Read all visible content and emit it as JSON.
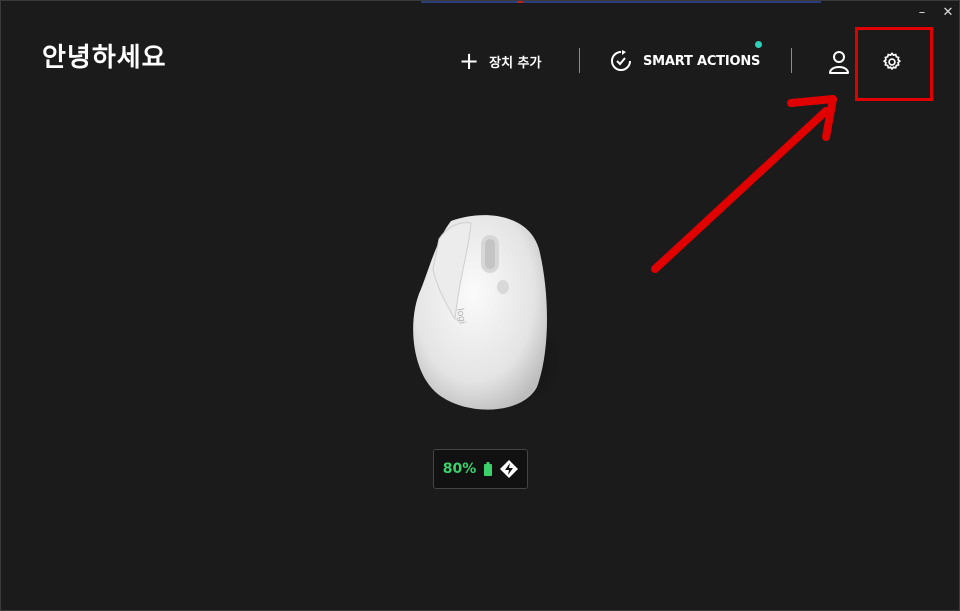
{
  "window": {
    "minimize_label": "–",
    "close_label": "✕"
  },
  "header": {
    "greeting": "안녕하세요",
    "add_device_label": "장치 추가",
    "smart_actions_label": "SMART ACTIONS",
    "notification_color": "#2ed0b8"
  },
  "device": {
    "battery_percent": "80%",
    "battery_color": "#3ad16a",
    "device_logo_text": "logi"
  },
  "icons": {
    "add": "plus-icon",
    "smart_actions": "smart-actions-icon",
    "account": "user-icon",
    "settings": "gear-icon",
    "battery": "battery-icon",
    "connection": "logi-bolt-icon"
  },
  "annotation": {
    "highlight_color": "#e00000"
  }
}
